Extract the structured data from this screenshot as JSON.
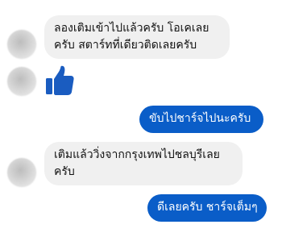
{
  "messages": {
    "m1": {
      "line1": "ลองเติมเข้าไปแล้วครับ โอเคเลย",
      "line2": "ครับ สตาร์ทที่เดียวติดเลยครับ"
    },
    "m2": {
      "icon": "thumbs-up-icon"
    },
    "m3": {
      "text": "ขับไปชาร์จไปนะครับ"
    },
    "m4": {
      "line1": "เติมแล้ววิ่งจากกรุงเทพไปชลบุรีเลย",
      "line2": "ครับ"
    },
    "m5": {
      "text": "ดีเลยครับ ชาร์จเต็มๆ"
    }
  },
  "colors": {
    "incoming_bubble": "#f0f0f0",
    "outgoing_bubble": "#0a5dc8",
    "like_icon": "#1a5cc0"
  }
}
